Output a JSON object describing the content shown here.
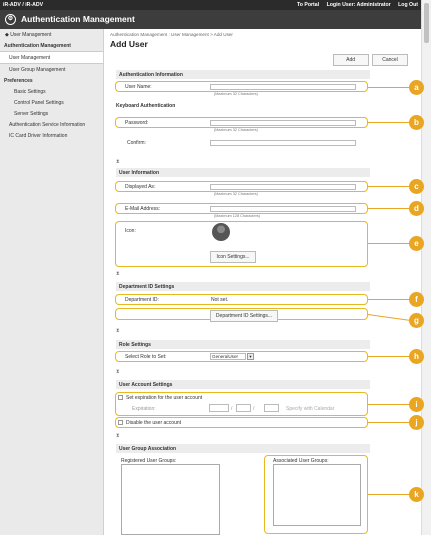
{
  "topbar": {
    "device": "iR-ADV",
    "device_sep": "/ iR-ADV",
    "to_portal": "To Portal",
    "login_user": "Login User: Administrator",
    "logout": "Log Out"
  },
  "app_title": "Authentication Management",
  "sidebar": {
    "back": "User Management",
    "section1": "Authentication Management",
    "items1": [
      "User Management",
      "User Group Management"
    ],
    "section2": "Preferences",
    "items2": [
      "Basic Settings",
      "Control Panel Settings",
      "Server Settings"
    ],
    "items3": [
      "Authentication Service Information",
      "IC Card Driver Information"
    ]
  },
  "main": {
    "breadcrumb": "Authentication Management : User Management > Add User",
    "title": "Add User",
    "add": "Add",
    "cancel": "Cancel"
  },
  "auth_info": {
    "header": "Authentication Information",
    "user_name_label": "User Name:",
    "hint": "(Maximum 32 Characters)"
  },
  "keyboard": {
    "header": "Keyboard Authentication",
    "password_label": "Password:",
    "confirm_label": "Confirm:",
    "hint": "(Maximum 32 Characters)"
  },
  "user_info": {
    "header": "User Information",
    "displayed_as_label": "Displayed As:",
    "hint": "(Maximum 32 Characters)",
    "email_label": "E-Mail Address:",
    "email_hint": "(Maximum 128 Characters)",
    "icon_label": "Icon:",
    "icon_settings": "Icon Settings..."
  },
  "dept": {
    "header": "Department ID Settings",
    "id_label": "Department ID:",
    "id_value": "Not set.",
    "settings_btn": "Department ID Settings..."
  },
  "role": {
    "header": "Role Settings",
    "select_label": "Select Role to Set:",
    "selected": "GeneralUser"
  },
  "account": {
    "header": "User Account Settings",
    "set_expiration": "Set expiration for the user account",
    "expiration_label": "Expiration:",
    "calendar": "Specify with Calendar",
    "disable": "Disable the user account"
  },
  "group": {
    "header": "User Group Association",
    "registered": "Registered User Groups:",
    "associated": "Associated User Groups:"
  },
  "callouts": [
    "a",
    "b",
    "c",
    "d",
    "e",
    "f",
    "g",
    "h",
    "i",
    "j",
    "k"
  ],
  "colors": {
    "callout": "#e8a622",
    "highlight": "#e8b820",
    "topbar": "#2b2b2b"
  }
}
